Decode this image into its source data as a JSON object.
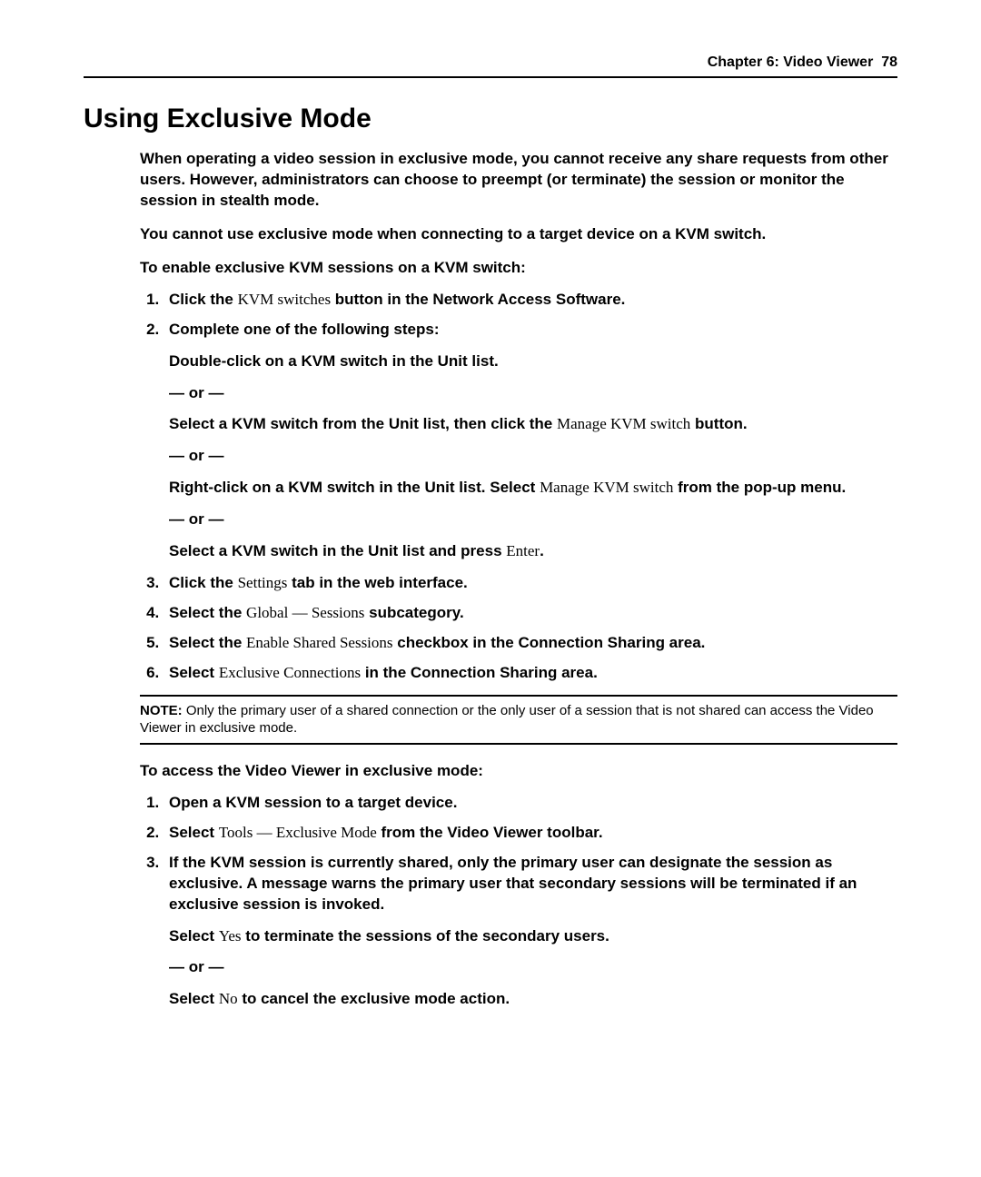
{
  "header": {
    "chapter": "Chapter 6: Video Viewer",
    "page": "78"
  },
  "title": "Using Exclusive Mode",
  "p1": "When operating a video session in exclusive mode, you cannot receive any share requests from other users. However, administrators can choose to preempt (or terminate) the session or monitor the session in stealth mode.",
  "p2": "You cannot use exclusive mode when connecting to a target device on a KVM switch.",
  "sub1": "To enable exclusive KVM sessions on a KVM switch:",
  "or": "— or —",
  "s1": {
    "a": "Click the ",
    "ui": "KVM switches",
    "b": " button in the Network Access Software."
  },
  "s2": "Complete one of the following steps:",
  "s2a": "Double-click on a KVM switch in the Unit list.",
  "s2b": {
    "a": "Select a KVM switch from the Unit list, then click the ",
    "ui": "Manage KVM switch",
    "b": " button."
  },
  "s2c": {
    "a": "Right-click on a KVM switch in the Unit list. Select ",
    "ui": "Manage KVM switch",
    "b": " from the pop-up menu."
  },
  "s2d": {
    "a": "Select a KVM switch in the Unit list and press ",
    "ui": "Enter",
    "b": "."
  },
  "s3": {
    "a": "Click the ",
    "ui": "Settings",
    "b": " tab in the web interface."
  },
  "s4": {
    "a": "Select the ",
    "ui": "Global — Sessions",
    "b": " subcategory."
  },
  "s5": {
    "a": "Select the ",
    "ui": "Enable Shared Sessions",
    "b": " checkbox in the Connection Sharing area."
  },
  "s6": {
    "a": "Select ",
    "ui": "Exclusive Connections",
    "b": " in the Connection Sharing area."
  },
  "note": {
    "label": "NOTE:",
    "text": " Only the primary user of a shared connection or the only user of a session that is not shared can access the Video Viewer in exclusive mode."
  },
  "sub2": "To access the Video Viewer in exclusive mode:",
  "t1": "Open a KVM session to a target device.",
  "t2": {
    "a": "Select ",
    "ui": "Tools — Exclusive Mode",
    "b": " from the Video Viewer toolbar."
  },
  "t3": "If the KVM session is currently shared, only the primary user can designate the session as exclusive. A message warns the primary user that secondary sessions will be terminated if an exclusive session is invoked.",
  "t3a": {
    "a": "Select ",
    "ui": "Yes",
    "b": " to terminate the sessions of the secondary users."
  },
  "t3b": {
    "a": "Select ",
    "ui": "No",
    "b": " to cancel the exclusive mode action."
  }
}
